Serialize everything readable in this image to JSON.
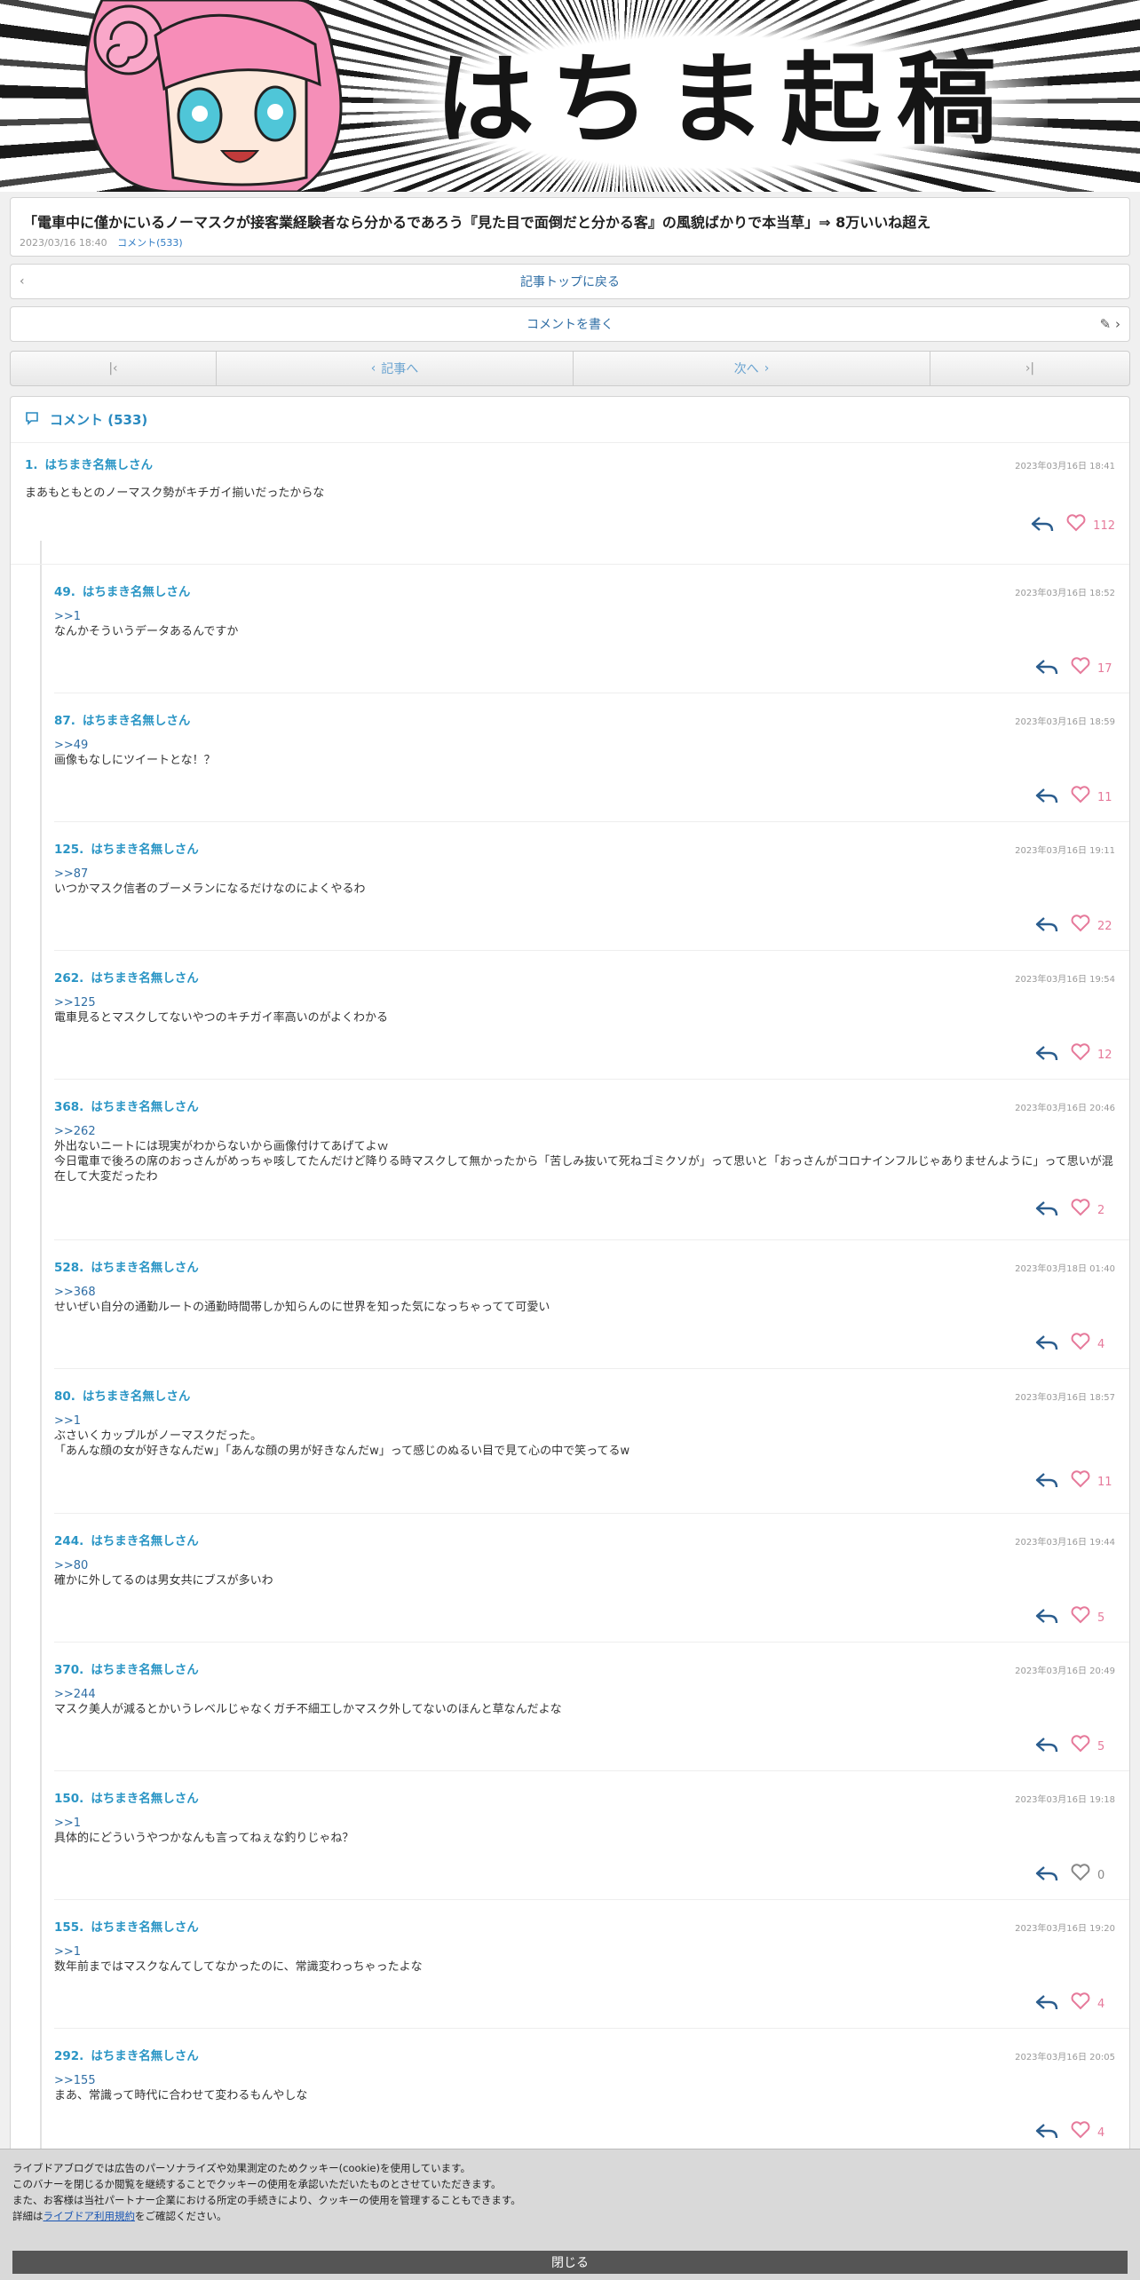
{
  "banner": {
    "title": "はちま起稿"
  },
  "article": {
    "title": "「電車中に僅かにいるノーマスクが接客業経験者なら分かるであろう『見た目で面倒だと分かる客』の風貌ばかりで本当草」⇒ 8万いいね超え",
    "date": "2023/03/16 18:40",
    "comment_link": "コメント(533)"
  },
  "nav": {
    "back_to_top": "記事トップに戻る",
    "write_comment": "コメントを書く",
    "prev": "記事へ",
    "next": "次へ",
    "left_arrow": "‹",
    "first_glyph": "|‹",
    "last_glyph": "›|",
    "prev_glyph": "‹",
    "next_glyph": "›",
    "pencil_glyph": "✎ ›"
  },
  "comments_header": "コメント (533)",
  "comments": [
    {
      "no": "1.",
      "name": "はちまき名無しさん",
      "time": "2023年03月16日 18:41",
      "anchor": "",
      "text": "まあもともとのノーマスク勢がキチガイ揃いだったからな",
      "likes": "112"
    },
    {
      "no": "49.",
      "name": "はちまき名無しさん",
      "time": "2023年03月16日 18:52",
      "anchor": ">>1",
      "text": "なんかそういうデータあるんですか",
      "likes": "17"
    },
    {
      "no": "87.",
      "name": "はちまき名無しさん",
      "time": "2023年03月16日 18:59",
      "anchor": ">>49",
      "text": "画像もなしにツイートとな！？",
      "likes": "11"
    },
    {
      "no": "125.",
      "name": "はちまき名無しさん",
      "time": "2023年03月16日 19:11",
      "anchor": ">>87",
      "text": "いつかマスク信者のブーメランになるだけなのによくやるわ",
      "likes": "22"
    },
    {
      "no": "262.",
      "name": "はちまき名無しさん",
      "time": "2023年03月16日 19:54",
      "anchor": ">>125",
      "text": "電車見るとマスクしてないやつのキチガイ率高いのがよくわかる",
      "likes": "12"
    },
    {
      "no": "368.",
      "name": "はちまき名無しさん",
      "time": "2023年03月16日 20:46",
      "anchor": ">>262",
      "text": "外出ないニートには現実がわからないから画像付けてあげてよｗ\n今日電車で後ろの席のおっさんがめっちゃ咳してたんだけど降りる時マスクして無かったから「苦しみ抜いて死ねゴミクソが」って思いと「おっさんがコロナインフルじゃありませんように」って思いが混在して大変だったわ",
      "likes": "2"
    },
    {
      "no": "528.",
      "name": "はちまき名無しさん",
      "time": "2023年03月18日 01:40",
      "anchor": ">>368",
      "text": "せいぜい自分の通勤ルートの通勤時間帯しか知らんのに世界を知った気になっちゃってて可愛い",
      "likes": "4"
    },
    {
      "no": "80.",
      "name": "はちまき名無しさん",
      "time": "2023年03月16日 18:57",
      "anchor": ">>1",
      "text": "ぶさいくカップルがノーマスクだった。\n「あんな顔の女が好きなんだw」「あんな顔の男が好きなんだw」って感じのぬるい目で見て心の中で笑ってるw",
      "likes": "11"
    },
    {
      "no": "244.",
      "name": "はちまき名無しさん",
      "time": "2023年03月16日 19:44",
      "anchor": ">>80",
      "text": "確かに外してるのは男女共にブスが多いわ",
      "likes": "5"
    },
    {
      "no": "370.",
      "name": "はちまき名無しさん",
      "time": "2023年03月16日 20:49",
      "anchor": ">>244",
      "text": "マスク美人が減るとかいうレベルじゃなくガチ不細工しかマスク外してないのほんと草なんだよな",
      "likes": "5"
    },
    {
      "no": "150.",
      "name": "はちまき名無しさん",
      "time": "2023年03月16日 19:18",
      "anchor": ">>1",
      "text": "具体的にどういうやつかなんも言ってねぇな釣りじゃね？",
      "likes": "0"
    },
    {
      "no": "155.",
      "name": "はちまき名無しさん",
      "time": "2023年03月16日 19:20",
      "anchor": ">>1",
      "text": "数年前まではマスクなんてしてなかったのに、常識変わっちゃったよな",
      "likes": "4"
    },
    {
      "no": "292.",
      "name": "はちまき名無しさん",
      "time": "2023年03月16日 20:05",
      "anchor": ">>155",
      "text": "まあ、常識って時代に合わせて変わるもんやしな",
      "likes": "4"
    }
  ],
  "icons": {
    "reply": "reply-arrow-icon",
    "like": "heart-icon",
    "comment": "speech-bubble-icon"
  },
  "colors": {
    "accent": "#2a95c5",
    "like": "#e67a9b",
    "reply": "#2b5d8e"
  },
  "cookie": {
    "line1": "ライブドアブログでは広告のパーソナライズや効果測定のためクッキー(cookie)を使用しています。",
    "line2": "このバナーを閉じるか閲覧を継続することでクッキーの使用を承認いただいたものとさせていただきます。",
    "line3": "また、お客様は当社パートナー企業における所定の手続きにより、クッキーの使用を管理することもできます。",
    "line4_pre": "詳細は",
    "line4_link": "ライブドア利用規約",
    "line4_post": "をご確認ください。",
    "close": "閉じる"
  }
}
